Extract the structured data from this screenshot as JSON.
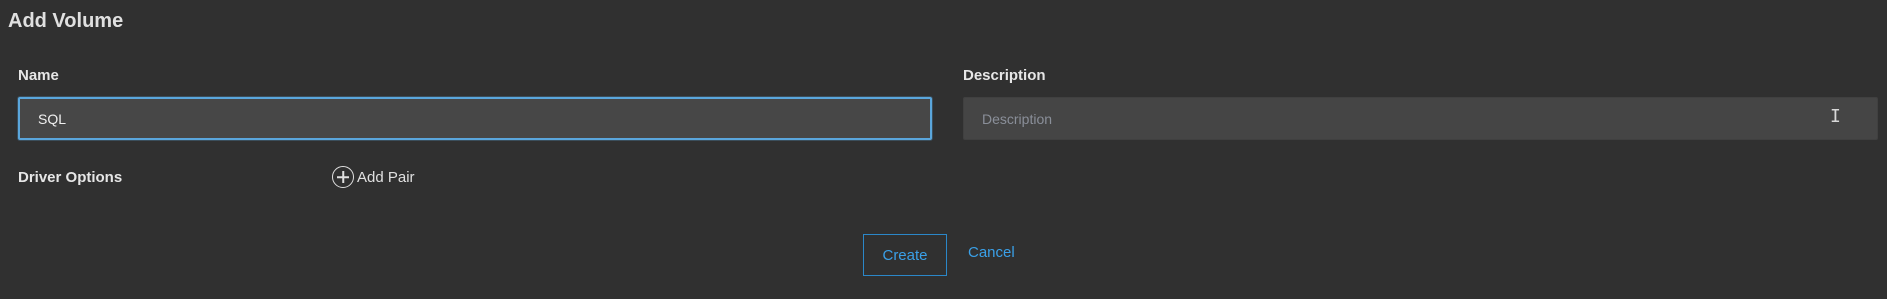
{
  "dialog": {
    "title": "Add Volume"
  },
  "form": {
    "name_label": "Name",
    "name_value": "SQL",
    "description_label": "Description",
    "description_placeholder": "Description",
    "description_value": "",
    "driver_options_label": "Driver Options",
    "add_pair_label": "Add Pair",
    "add_pair_icon": "plus-circle-icon"
  },
  "actions": {
    "create_label": "Create",
    "cancel_label": "Cancel"
  },
  "colors": {
    "background": "#303030",
    "input_background": "#474747",
    "focus_border": "#5aa6dc",
    "accent": "#3aa0e8"
  }
}
